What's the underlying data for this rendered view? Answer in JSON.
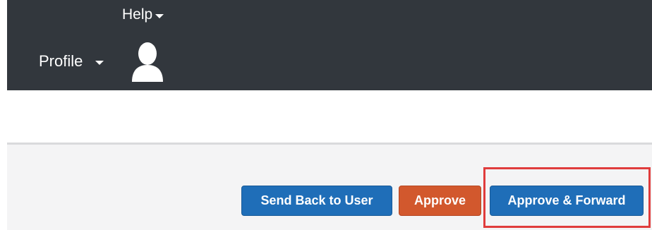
{
  "header": {
    "help_label": "Help",
    "profile_label": "Profile",
    "avatar_icon": "user-avatar-icon",
    "background_color": "#32373d"
  },
  "actions": {
    "send_back_label": "Send Back to User",
    "approve_label": "Approve",
    "approve_forward_label": "Approve & Forward",
    "primary_color": "#1f6eb8",
    "approve_color": "#d2582d",
    "highlight_color": "#e03c3c"
  }
}
